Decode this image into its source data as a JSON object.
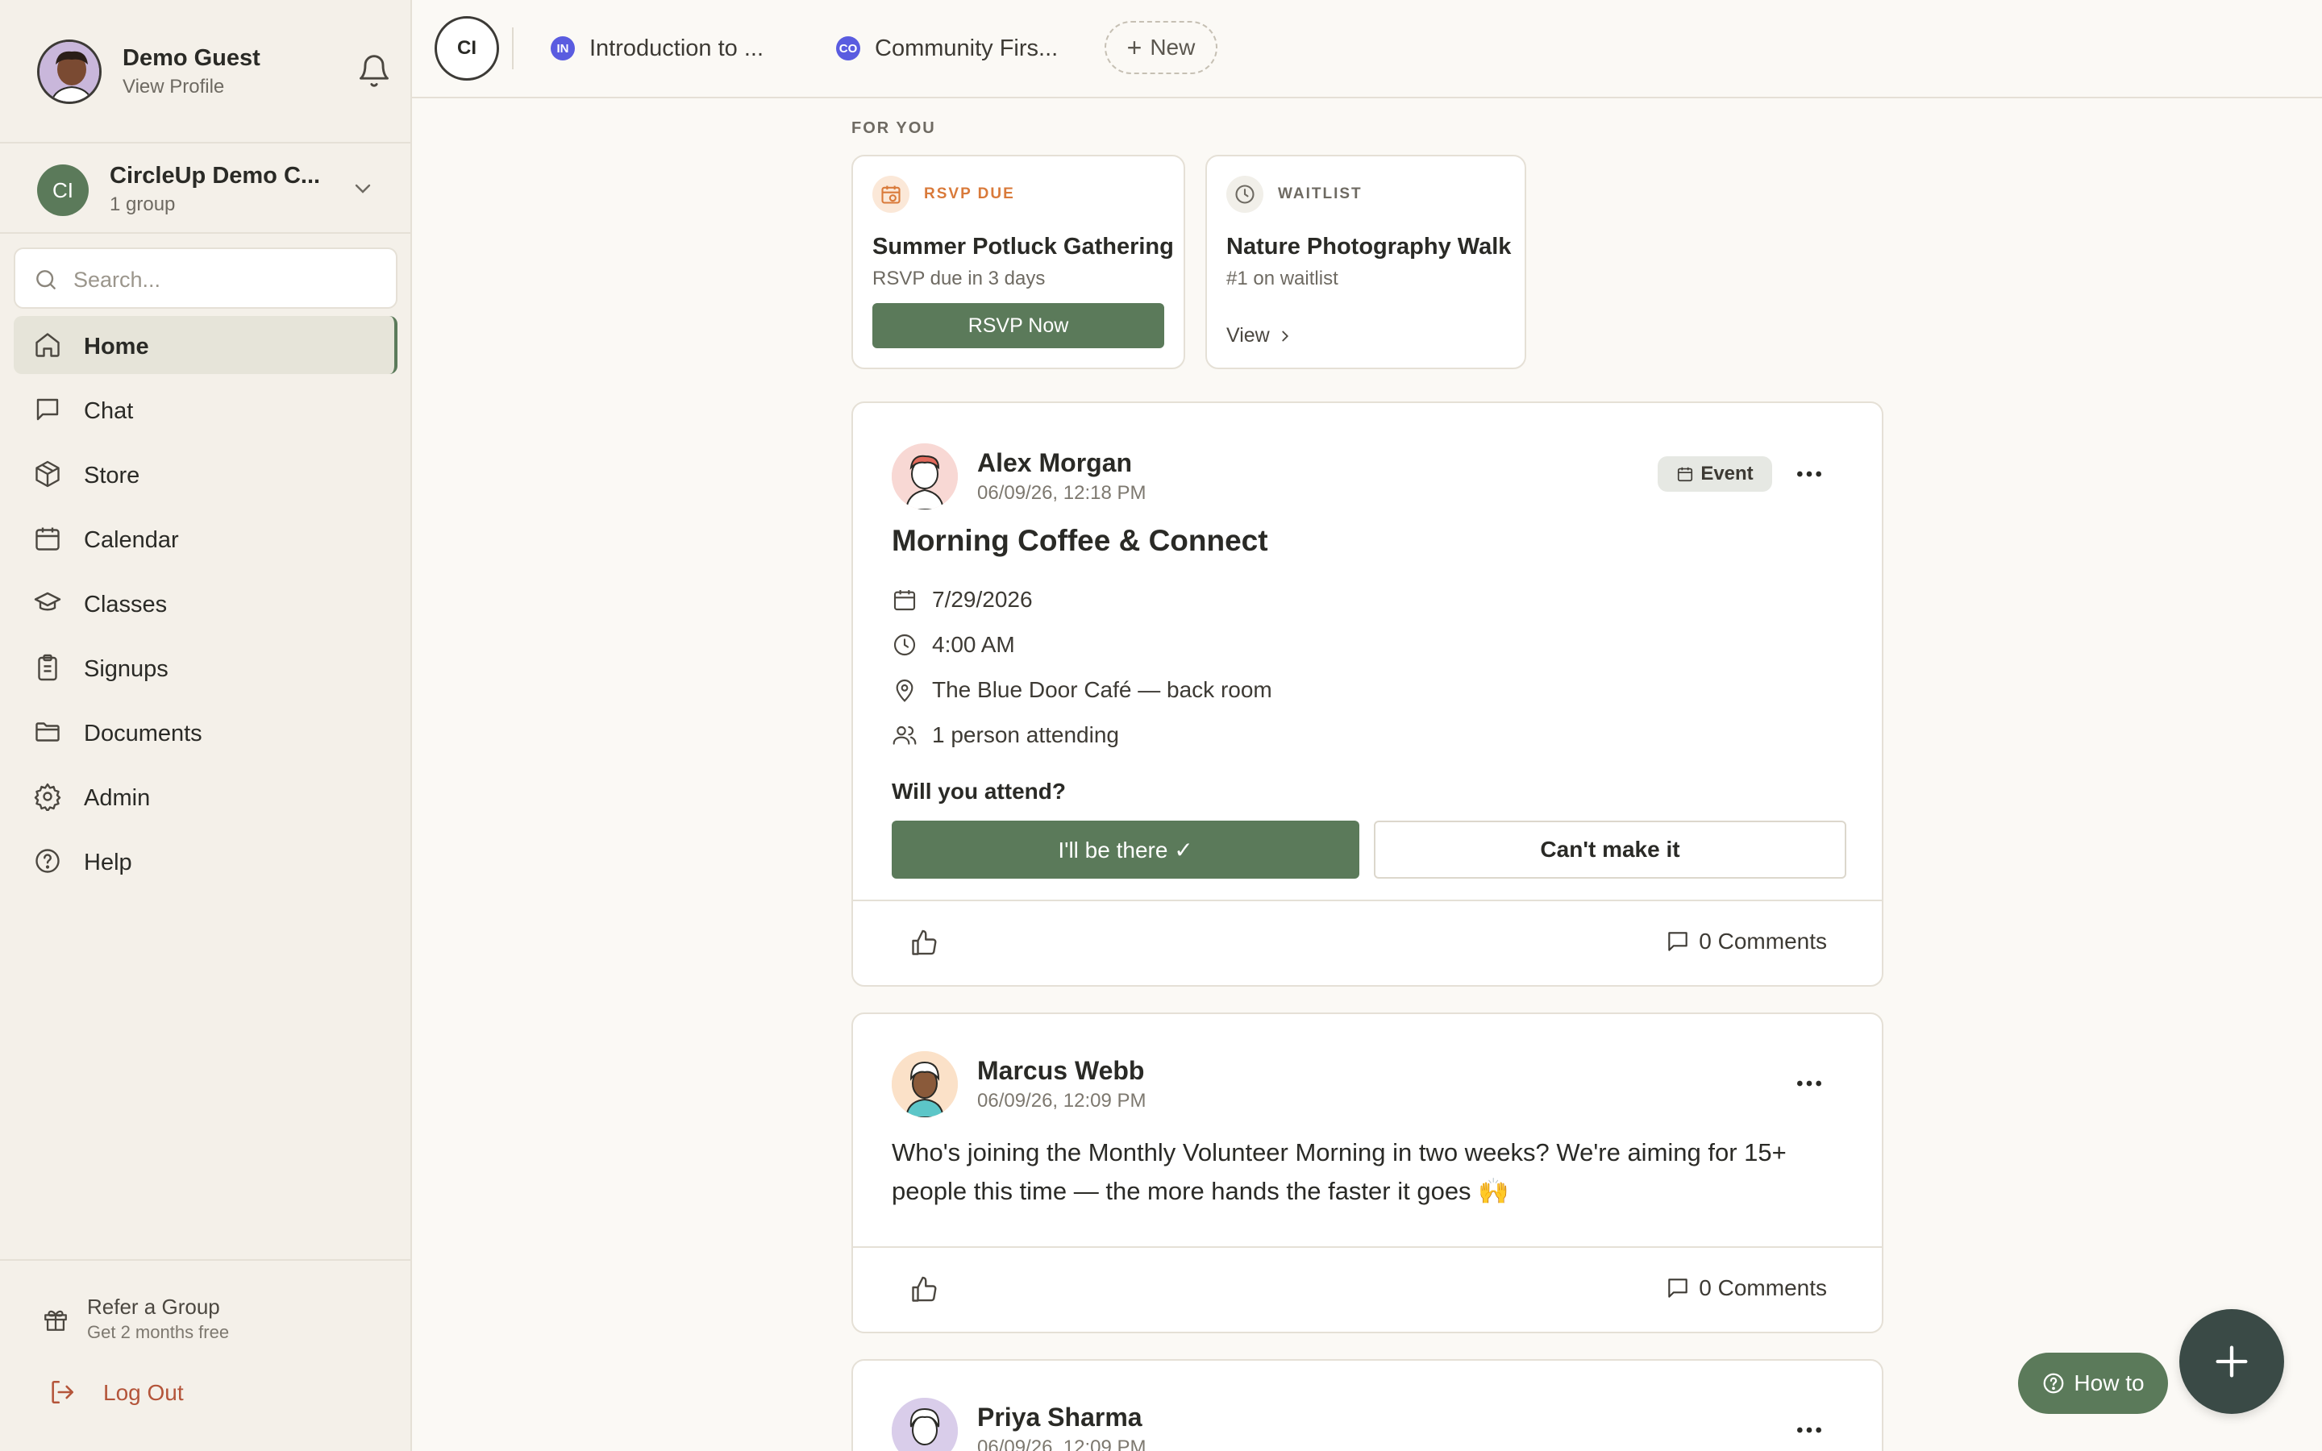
{
  "colors": {
    "accent": "#5b7a5a",
    "rsvp_orange": "#d97a3a",
    "tab_dot": "#5a5ce0",
    "logout_red": "#b4553a"
  },
  "profile": {
    "name": "Demo Guest",
    "sub": "View Profile"
  },
  "group": {
    "badge": "CI",
    "name": "CircleUp Demo C...",
    "count": "1 group"
  },
  "search": {
    "placeholder": "Search..."
  },
  "nav": [
    {
      "label": "Home",
      "icon": "home-icon",
      "active": true
    },
    {
      "label": "Chat",
      "icon": "chat-icon"
    },
    {
      "label": "Store",
      "icon": "box-icon"
    },
    {
      "label": "Calendar",
      "icon": "calendar-icon"
    },
    {
      "label": "Classes",
      "icon": "graduation-cap-icon"
    },
    {
      "label": "Signups",
      "icon": "clipboard-icon"
    },
    {
      "label": "Documents",
      "icon": "folder-icon"
    },
    {
      "label": "Admin",
      "icon": "gear-icon"
    },
    {
      "label": "Help",
      "icon": "help-circle-icon"
    }
  ],
  "refer": {
    "title": "Refer a Group",
    "sub": "Get 2 months free"
  },
  "logout": {
    "label": "Log Out"
  },
  "tabs": {
    "home_badge": "CI",
    "items": [
      {
        "badge": "IN",
        "label": "Introduction to ..."
      },
      {
        "badge": "CO",
        "label": "Community Firs..."
      }
    ],
    "new_label": "New"
  },
  "for_you": {
    "heading": "FOR YOU",
    "cards": [
      {
        "kind": "RSVP DUE",
        "title": "Summer Potluck Gathering",
        "sub": "RSVP due in 3 days",
        "action": "RSVP Now"
      },
      {
        "kind": "WAITLIST",
        "title": "Nature Photography Walk",
        "sub": "#1 on waitlist",
        "action": "View"
      }
    ]
  },
  "posts": [
    {
      "author": "Alex Morgan",
      "date": "06/09/26, 12:18 PM",
      "badge": "Event",
      "title": "Morning Coffee & Connect",
      "event_date": "7/29/2026",
      "event_time": "4:00 AM",
      "location": "The Blue Door Café — back room",
      "attending": "1 person attending",
      "question": "Will you attend?",
      "yes_label": "I'll be there ✓",
      "no_label": "Can't make it",
      "comments": "0 Comments"
    },
    {
      "author": "Marcus Webb",
      "date": "06/09/26, 12:09 PM",
      "body": "Who's joining the Monthly Volunteer Morning in two weeks? We're aiming for 15+ people this time — the more hands the faster it goes 🙌",
      "comments": "0 Comments"
    },
    {
      "author": "Priya Sharma",
      "date": "06/09/26, 12:09 PM"
    }
  ],
  "floating": {
    "howto_label": "How to"
  }
}
